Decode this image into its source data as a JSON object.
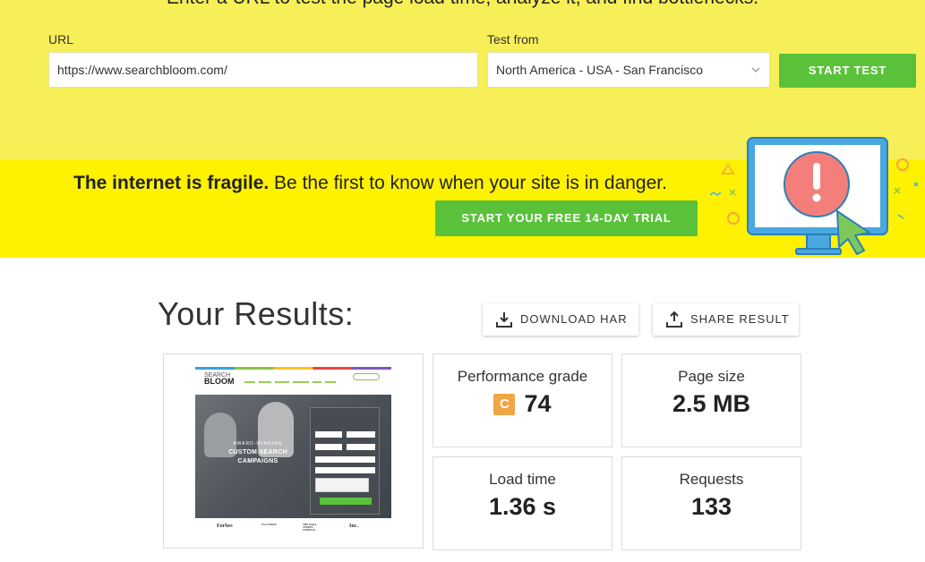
{
  "header": {
    "cut_text": "Enter a URL to test the page load time, analyze it, and find bottlenecks."
  },
  "form": {
    "url_label": "URL",
    "url_value": "https://www.searchbloom.com/",
    "test_from_label": "Test from",
    "test_from_value": "North America - USA - San Francisco",
    "start_label": "START TEST"
  },
  "banner": {
    "bold": "The internet is fragile.",
    "text": " Be the first to know when your site is in danger.",
    "trial_label": "START YOUR FREE 14-DAY TRIAL"
  },
  "results": {
    "title": "Your Results:",
    "download_label": "DOWNLOAD HAR",
    "share_label": "SHARE RESULT",
    "performance_label": "Performance grade",
    "grade_letter": "C",
    "grade_value": "74",
    "page_size_label": "Page size",
    "page_size_value": "2.5 MB",
    "load_time_label": "Load time",
    "load_time_value": "1.36 s",
    "requests_label": "Requests",
    "requests_value": "133"
  },
  "screenshot": {
    "logo_top": "SEARCH",
    "logo_bottom": "BLOOM",
    "hero_line1": "AWARD-WINNING",
    "hero_line2": "CUSTOM SEARCH",
    "hero_line3": "CAMPAIGNS",
    "logos": [
      "Forbes",
      "USA TODAY",
      "THE WALL STREET JOURNAL",
      "Inc."
    ]
  },
  "colors": {
    "top_band": "#f6ef58",
    "banner": "#fff200",
    "accent_green": "#5ac23a",
    "grade_c": "#f1a646"
  }
}
